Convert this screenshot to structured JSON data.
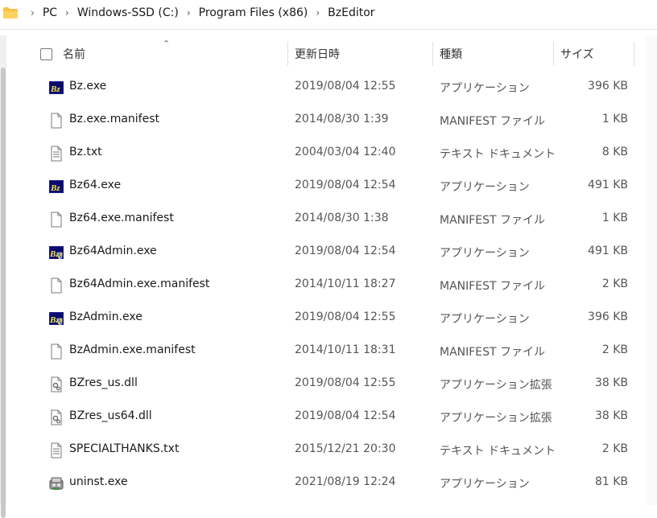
{
  "breadcrumb": {
    "items": [
      "PC",
      "Windows-SSD (C:)",
      "Program Files (x86)",
      "BzEditor"
    ],
    "separator": "›"
  },
  "columns": {
    "name": "名前",
    "date": "更新日時",
    "type": "種類",
    "size": "サイズ"
  },
  "files": [
    {
      "name": "Bz.exe",
      "date": "2019/08/04 12:55",
      "type": "アプリケーション",
      "size": "396 KB",
      "icon": "bz-app-icon"
    },
    {
      "name": "Bz.exe.manifest",
      "date": "2014/08/30 1:39",
      "type": "MANIFEST ファイル",
      "size": "1 KB",
      "icon": "blank-file-icon"
    },
    {
      "name": "Bz.txt",
      "date": "2004/03/04 12:40",
      "type": "テキスト ドキュメント",
      "size": "8 KB",
      "icon": "text-file-icon"
    },
    {
      "name": "Bz64.exe",
      "date": "2019/08/04 12:54",
      "type": "アプリケーション",
      "size": "491 KB",
      "icon": "bz-app-icon"
    },
    {
      "name": "Bz64.exe.manifest",
      "date": "2014/08/30 1:38",
      "type": "MANIFEST ファイル",
      "size": "1 KB",
      "icon": "blank-file-icon"
    },
    {
      "name": "Bz64Admin.exe",
      "date": "2019/08/04 12:54",
      "type": "アプリケーション",
      "size": "491 KB",
      "icon": "bz-admin-app-icon"
    },
    {
      "name": "Bz64Admin.exe.manifest",
      "date": "2014/10/11 18:27",
      "type": "MANIFEST ファイル",
      "size": "2 KB",
      "icon": "blank-file-icon"
    },
    {
      "name": "BzAdmin.exe",
      "date": "2019/08/04 12:55",
      "type": "アプリケーション",
      "size": "396 KB",
      "icon": "bz-admin-app-icon"
    },
    {
      "name": "BzAdmin.exe.manifest",
      "date": "2014/10/11 18:31",
      "type": "MANIFEST ファイル",
      "size": "2 KB",
      "icon": "blank-file-icon"
    },
    {
      "name": "BZres_us.dll",
      "date": "2019/08/04 12:55",
      "type": "アプリケーション拡張",
      "size": "38 KB",
      "icon": "dll-file-icon"
    },
    {
      "name": "BZres_us64.dll",
      "date": "2019/08/04 12:54",
      "type": "アプリケーション拡張",
      "size": "38 KB",
      "icon": "dll-file-icon"
    },
    {
      "name": "SPECIALTHANKS.txt",
      "date": "2015/12/21 20:30",
      "type": "テキスト ドキュメント",
      "size": "2 KB",
      "icon": "text-file-icon"
    },
    {
      "name": "uninst.exe",
      "date": "2021/08/19 12:24",
      "type": "アプリケーション",
      "size": "81 KB",
      "icon": "uninstaller-icon"
    }
  ]
}
